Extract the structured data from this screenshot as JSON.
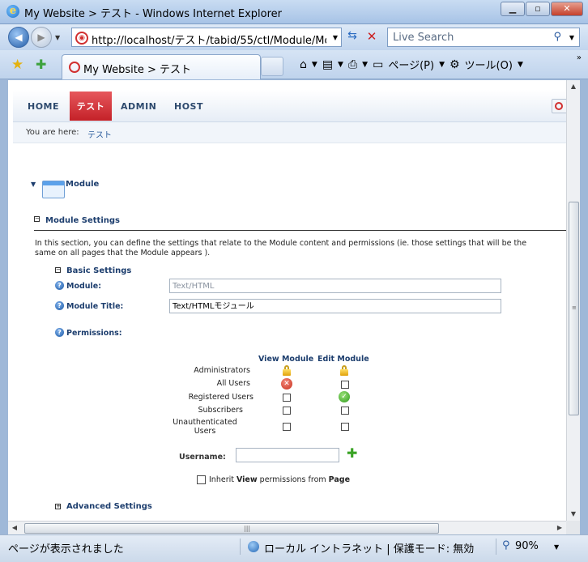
{
  "window": {
    "title": "My Website > テスト - Windows Internet Explorer",
    "minimize": "▁",
    "maximize": "▫",
    "close": "✕"
  },
  "nav": {
    "url": "http://localhost/テスト/tabid/55/ctl/Module/Modu",
    "search_placeholder": "Live Search"
  },
  "tabs": {
    "active_label": "My Website > テスト"
  },
  "commands": {
    "page": "ページ(P)",
    "tools": "ツール(O)"
  },
  "site": {
    "menu": [
      "HOME",
      "テスト",
      "ADMIN",
      "HOST"
    ],
    "breadcrumb_label": "You are here:",
    "breadcrumb_link": "テスト",
    "breadcrumb_right": "S"
  },
  "module": {
    "title": "Module",
    "section_title": "Module Settings",
    "section_desc": "In this section, you can define the settings that relate to the Module content and permissions (ie. those settings that will be the same on all pages that the Module appears ).",
    "basic_title": "Basic Settings",
    "module_label": "Module:",
    "module_value": "Text/HTML",
    "module_title_label": "Module Title:",
    "module_title_value": "Text/HTMLモジュール",
    "permissions_label": "Permissions:",
    "perm_col_view": "View Module",
    "perm_col_edit": "Edit Module",
    "roles": [
      "Administrators",
      "All Users",
      "Registered Users",
      "Subscribers",
      "Unauthenticated Users"
    ],
    "username_label": "Username:",
    "inherit_pre": "Inherit ",
    "inherit_view": "View",
    "inherit_mid": " permissions from ",
    "inherit_page": "Page",
    "advanced_title": "Advanced Settings"
  },
  "status": {
    "message": "ページが表示されました",
    "zone": "ローカル イントラネット | 保護モード: 無効",
    "zoom": "90%"
  }
}
